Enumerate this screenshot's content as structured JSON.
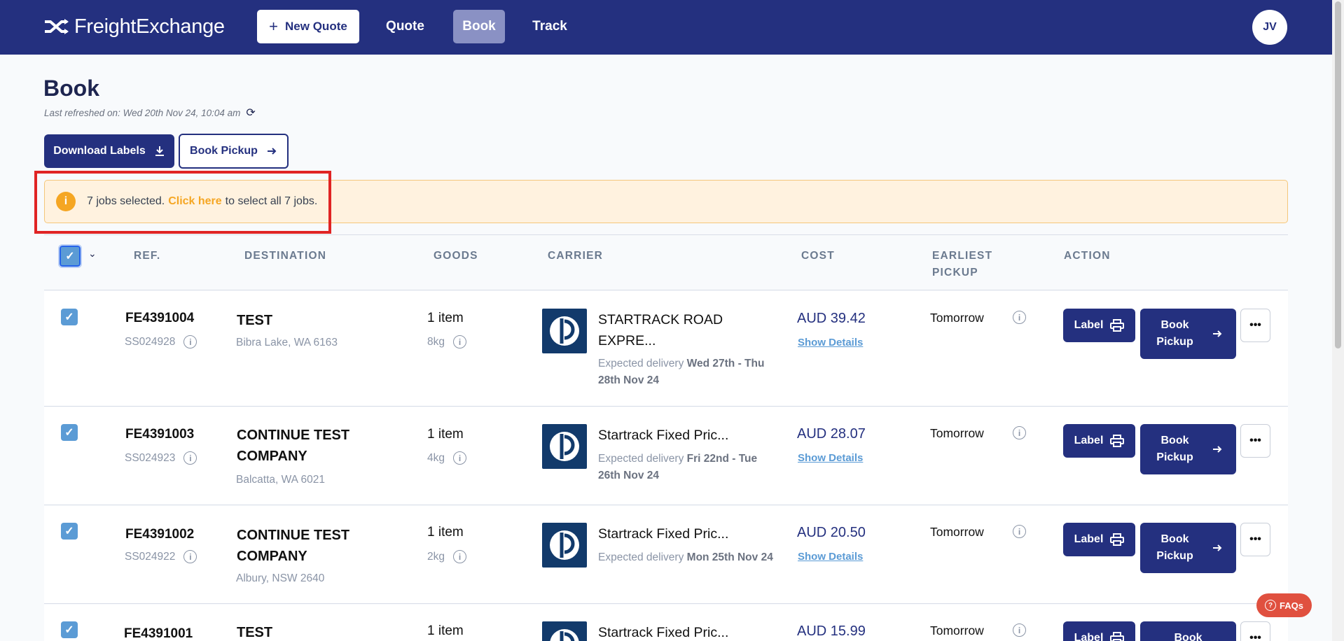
{
  "header": {
    "logo_text": "FreightExchange",
    "new_quote_label": "New Quote",
    "nav": [
      "Quote",
      "Book",
      "Track"
    ],
    "avatar_initials": "JV"
  },
  "page": {
    "title": "Book",
    "last_refreshed": "Last refreshed on: Wed 20th Nov 24, 10:04 am",
    "download_labels": "Download Labels",
    "book_pickup": "Book Pickup"
  },
  "alert": {
    "prefix": "7 jobs selected.",
    "link": "Click here",
    "suffix": "to select all 7 jobs."
  },
  "table": {
    "headers": {
      "ref": "REF.",
      "destination": "DESTINATION",
      "goods": "GOODS",
      "carrier": "CARRIER",
      "cost": "COST",
      "earliest_pickup": "EARLIEST\nPICKUP",
      "action": "ACTION"
    },
    "rows": [
      {
        "ref": "FE4391004",
        "subref": "SS024928",
        "destination": "TEST",
        "location": "Bibra Lake, WA 6163",
        "goods": "1 item",
        "weight": "8kg",
        "carrier": "STARTRACK ROAD EXPRE...",
        "expected_prefix": "Expected delivery",
        "expected_dates": "Wed 27th - Thu 28th Nov 24",
        "cost": "AUD 39.42",
        "show_details": "Show Details",
        "pickup": "Tomorrow",
        "label_btn": "Label",
        "book_btn": "Book Pickup"
      },
      {
        "ref": "FE4391003",
        "subref": "SS024923",
        "destination": "CONTINUE TEST COMPANY",
        "location": "Balcatta, WA 6021",
        "goods": "1 item",
        "weight": "4kg",
        "carrier": "Startrack Fixed Pric...",
        "expected_prefix": "Expected delivery",
        "expected_dates": "Fri 22nd - Tue 26th Nov 24",
        "cost": "AUD 28.07",
        "show_details": "Show Details",
        "pickup": "Tomorrow",
        "label_btn": "Label",
        "book_btn": "Book Pickup"
      },
      {
        "ref": "FE4391002",
        "subref": "SS024922",
        "destination": "CONTINUE TEST COMPANY",
        "location": "Albury, NSW 2640",
        "goods": "1 item",
        "weight": "2kg",
        "carrier": "Startrack Fixed Pric...",
        "expected_prefix": "Expected delivery",
        "expected_dates": "Mon 25th Nov 24",
        "cost": "AUD 20.50",
        "show_details": "Show Details",
        "pickup": "Tomorrow",
        "label_btn": "Label",
        "book_btn": "Book Pickup"
      },
      {
        "ref": "FE4391001",
        "destination": "TEST",
        "goods": "1 item",
        "carrier": "Startrack Fixed Pric...",
        "cost": "AUD 15.99",
        "pickup": "Tomorrow",
        "label_btn": "Label",
        "book_btn": "Book"
      }
    ]
  },
  "faqs": "FAQs"
}
